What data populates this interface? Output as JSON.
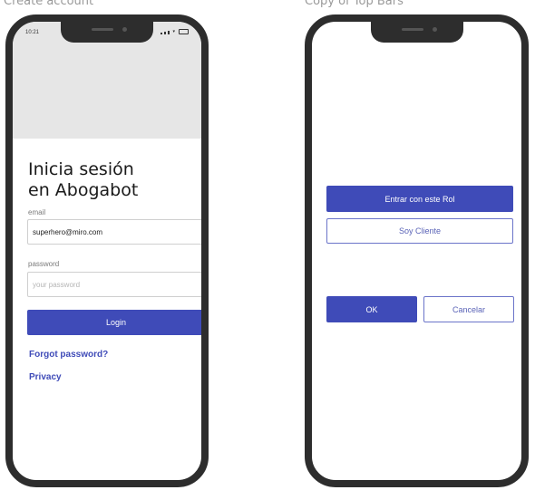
{
  "frames": [
    {
      "label": "Create account",
      "status_time": "10:21",
      "title_line1": "Inicia sesión",
      "title_line2": "en Abogabot",
      "email_label": "email",
      "email_value": "superhero@miro.com",
      "password_label": "password",
      "password_placeholder": "your password",
      "login_label": "Login",
      "forgot_label": "Forgot password?",
      "privacy_label": "Privacy"
    },
    {
      "label": "Copy of Top Bars",
      "role_button_label": "Entrar con este Rol",
      "client_button_label": "Soy Cliente",
      "ok_label": "OK",
      "cancel_label": "Cancelar"
    }
  ],
  "colors": {
    "accent": "#3f4bb8",
    "phone_frame": "#2d2d2d",
    "header_gray": "#e6e6e6"
  }
}
